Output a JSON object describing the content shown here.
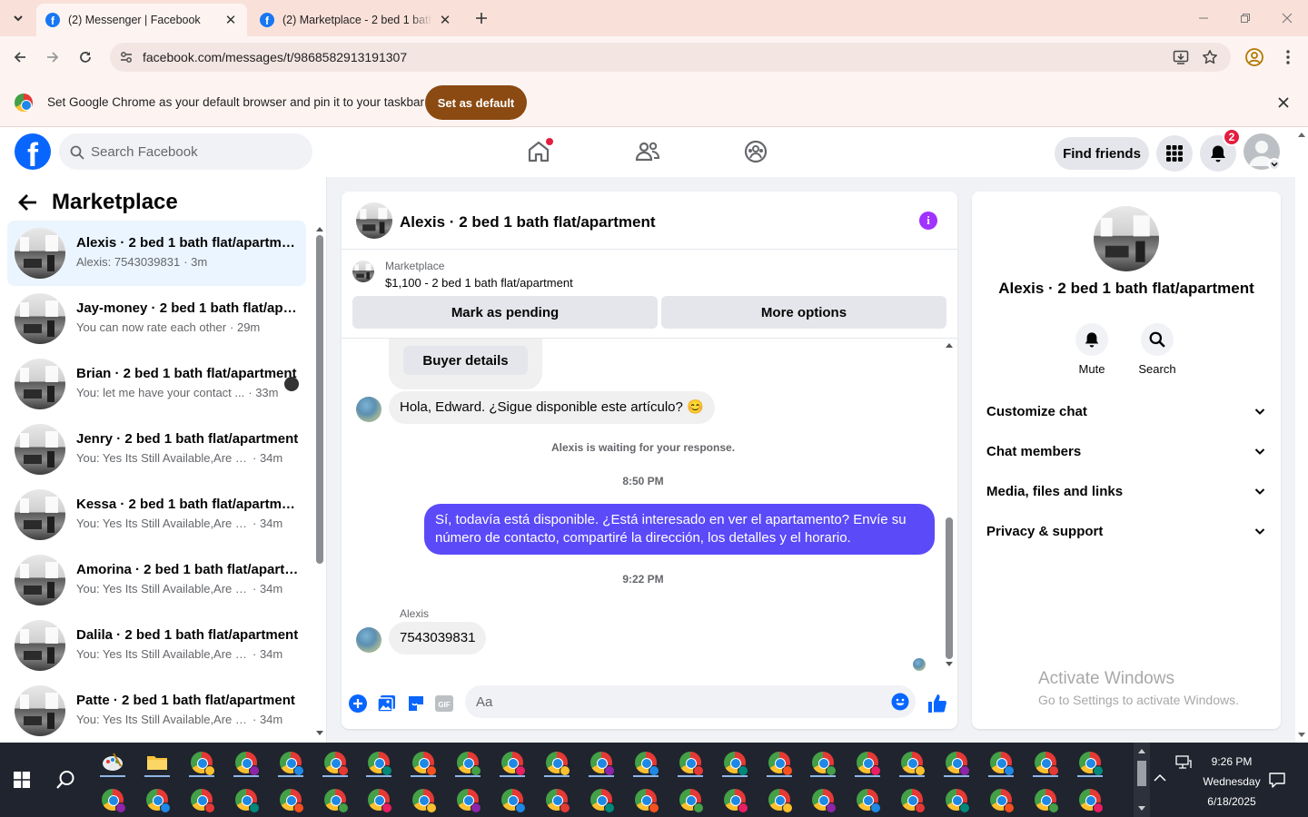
{
  "browser": {
    "tabs": [
      {
        "title": "(2) Messenger | Facebook",
        "active": true
      },
      {
        "title": "(2) Marketplace - 2 bed 1 bath flat/apartment",
        "active": false
      }
    ],
    "url": "facebook.com/messages/t/9868582913191307",
    "infobar": {
      "text": "Set Google Chrome as your default browser and pin it to your taskbar",
      "button": "Set as default"
    }
  },
  "header": {
    "search_placeholder": "Search Facebook",
    "find_friends": "Find friends",
    "notifications_count": "2"
  },
  "sidebar": {
    "title": "Marketplace",
    "conversations": [
      {
        "name": "Alexis · 2 bed 1 bath flat/apartment",
        "preview": "Alexis: 7543039831",
        "time": "· 3m",
        "selected": true
      },
      {
        "name": "Jay-money · 2 bed 1 bath flat/apartment",
        "preview": "You can now rate each other",
        "time": "· 29m"
      },
      {
        "name": "Brian · 2 bed 1 bath flat/apartment",
        "preview": "You: let me have your contact ...",
        "time": "· 33m",
        "seen": true
      },
      {
        "name": "Jenry · 2 bed 1 bath flat/apartment",
        "preview": "You: Yes Its Still Available,Are you ...",
        "time": "· 34m"
      },
      {
        "name": "Kessa · 2 bed 1 bath flat/apartment",
        "preview": "You: Yes Its Still Available,Are you ...",
        "time": "· 34m"
      },
      {
        "name": "Amorina · 2 bed 1 bath flat/apartment",
        "preview": "You: Yes Its Still Available,Are you ...",
        "time": "· 34m"
      },
      {
        "name": "Dalila · 2 bed 1 bath flat/apartment",
        "preview": "You: Yes Its Still Available,Are you ...",
        "time": "· 34m"
      },
      {
        "name": "Patte · 2 bed 1 bath flat/apartment",
        "preview": "You: Yes Its Still Available,Are you ...",
        "time": "· 34m"
      }
    ]
  },
  "chat": {
    "title": "Alexis · 2 bed 1 bath flat/apartment",
    "listing": {
      "label": "Marketplace",
      "summary": "$1,100 - 2 bed 1 bath flat/apartment",
      "mark_pending": "Mark as pending",
      "more_options": "More options"
    },
    "buyer_details": "Buyer details",
    "messages": {
      "m1": "Hola, Edward. ¿Sigue disponible este artículo? 😊",
      "waiting": "Alexis is waiting for your response.",
      "time1": "8:50 PM",
      "m2": "Sí, todavía está disponible. ¿Está interesado en ver el apartamento? Envíe su número de contacto, compartiré la dirección, los detalles y el horario.",
      "time2": "9:22 PM",
      "sender": "Alexis",
      "m3": "7543039831"
    },
    "input_placeholder": "Aa"
  },
  "details": {
    "name": "Alexis · 2 bed 1 bath flat/apartment",
    "actions": {
      "mute": "Mute",
      "search": "Search"
    },
    "sections": {
      "customize": "Customize chat",
      "members": "Chat members",
      "media": "Media, files and links",
      "privacy": "Privacy & support"
    }
  },
  "watermark": {
    "title": "Activate Windows",
    "subtitle": "Go to Settings to activate Windows."
  },
  "taskbar": {
    "time": "9:26 PM",
    "day": "Wednesday",
    "date": "6/18/2025"
  },
  "colors": {
    "accent": "#0866ff",
    "outgoing_bubble": "#5b4af7",
    "chrome_default_button": "#8a4a12",
    "info_icon": "#a033ff"
  }
}
